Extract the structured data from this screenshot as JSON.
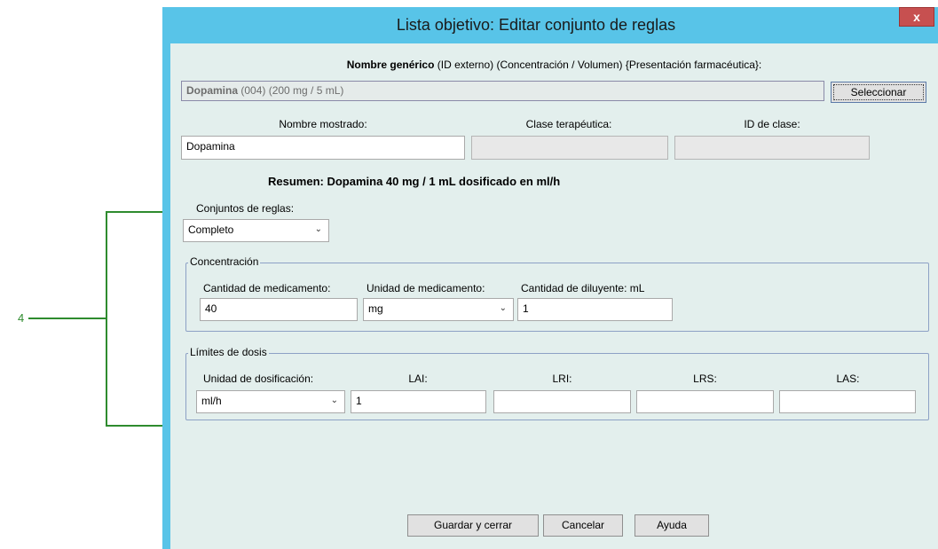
{
  "annotation": {
    "callout_number": "4"
  },
  "window": {
    "title": "Lista objetivo: Editar conjunto de reglas",
    "close_label": "x"
  },
  "header": {
    "bold": "Nombre genérico",
    "rest": " (ID externo) (Concentración / Volumen) {Presentación farmacéutica}:"
  },
  "drug": {
    "name": "Dopamina",
    "details": " (004) (200 mg / 5 mL)",
    "select_label": "Seleccionar"
  },
  "display": {
    "name_label": "Nombre mostrado:",
    "name_value": "Dopamina",
    "class_label": "Clase terapéutica:",
    "class_value": "",
    "class_id_label": "ID de clase:",
    "class_id_value": ""
  },
  "summary": "Resumen: Dopamina 40 mg / 1 mL dosificado en ml/h",
  "rule_sets": {
    "label": "Conjuntos de reglas:",
    "selected": "Completo"
  },
  "concentration": {
    "legend": "Concentración",
    "amount_label": "Cantidad de medicamento:",
    "amount_value": "40",
    "unit_label": "Unidad de medicamento:",
    "unit_value": "mg",
    "diluent_label": "Cantidad de diluyente: mL",
    "diluent_value": "1"
  },
  "dose_limits": {
    "legend": "Límites de dosis",
    "unit_label": "Unidad de dosificación:",
    "unit_value": "ml/h",
    "lai_label": "LAI:",
    "lai_value": "1",
    "lri_label": "LRI:",
    "lri_value": "",
    "lrs_label": "LRS:",
    "lrs_value": "",
    "las_label": "LAS:",
    "las_value": ""
  },
  "footer": {
    "save_label": "Guardar y cerrar",
    "cancel_label": "Cancelar",
    "help_label": "Ayuda"
  },
  "colors": {
    "window_frame": "#58c4e8",
    "client_bg": "#e3efed",
    "annotation_green": "#2e8b2e"
  }
}
